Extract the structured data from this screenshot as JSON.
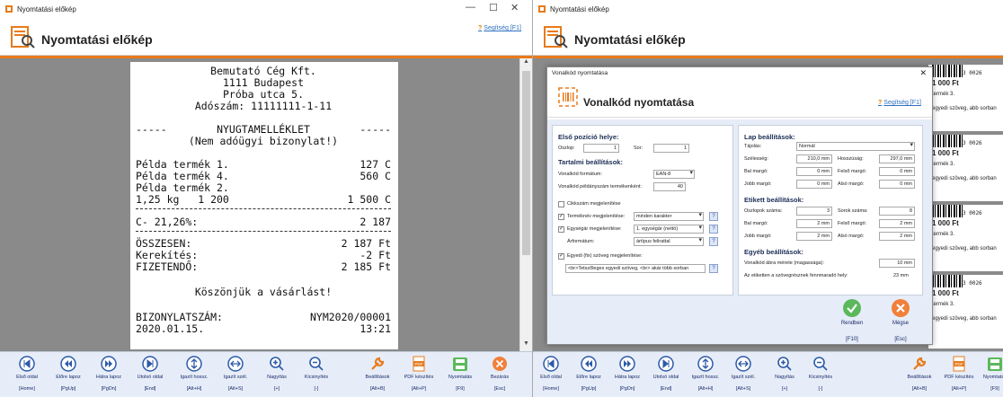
{
  "left": {
    "window_title": "Nyomtatási előkép",
    "header_title": "Nyomtatási előkép",
    "help_link": "Segítség [F1]",
    "receipt": {
      "company": "Bemutató Cég Kft.",
      "city": "1111 Budapest",
      "street": "Próba utca 5.",
      "tax_id": "Adószám: 11111111-1-11",
      "doc_title": "NYUGTAMELLÉKLET",
      "doc_subtitle": "(Nem adóügyi bizonylat!)",
      "items": [
        {
          "name": "Példa termék 1.",
          "amount": "127 C"
        },
        {
          "name": "Példa termék 4.",
          "amount": "560 C"
        },
        {
          "name": "Példa termék 2.",
          "amount": ""
        },
        {
          "name": "1,25 kg   1 200",
          "amount": "1 500 C"
        }
      ],
      "discount_label": "C- 21,26%:",
      "discount_value": "2 187",
      "total_label": "ÖSSZESEN:",
      "total_value": "2 187 Ft",
      "rounding_label": "Kerekítés:",
      "rounding_value": "-2 Ft",
      "payable_label": "FIZETENDŐ:",
      "payable_value": "2 185 Ft",
      "thanks": "Köszönjük a vásárlást!",
      "doc_number_label": "BIZONYLATSZÁM:",
      "doc_number": "NYM2020/00001",
      "date": "2020.01.15.",
      "time": "13:21"
    },
    "toolbar": [
      {
        "label": "Első oldal",
        "key": "[Home]",
        "icon": "first-page-icon"
      },
      {
        "label": "Előre lapoz",
        "key": "[PgUp]",
        "icon": "prev-page-icon"
      },
      {
        "label": "Hátra lapoz",
        "key": "[PgDn]",
        "icon": "next-page-icon"
      },
      {
        "label": "Utolsó oldal",
        "key": "[End]",
        "icon": "last-page-icon"
      },
      {
        "label": "Igazít hossz.",
        "key": "[Alt+H]",
        "icon": "fit-height-icon"
      },
      {
        "label": "Igazít szél.",
        "key": "[Alt+S]",
        "icon": "fit-width-icon"
      },
      {
        "label": "Nagyítás",
        "key": "[+]",
        "icon": "zoom-in-icon"
      },
      {
        "label": "Kicsinyítés",
        "key": "[-]",
        "icon": "zoom-out-icon"
      },
      {
        "label": "Beállítások",
        "key": "[Alt+B]",
        "icon": "wrench-icon"
      },
      {
        "label": "PDF készítés",
        "key": "[Alt+P]",
        "icon": "pdf-icon"
      },
      {
        "label": "Nyomtatás",
        "key": "[F9]",
        "icon": "printer-icon"
      },
      {
        "label": "Bezárás",
        "key": "[Esc]",
        "icon": "close-circle-icon"
      }
    ]
  },
  "right": {
    "window_title": "Nyomtatási előkép",
    "header_title": "Nyomtatási előkép",
    "help_link": "Segítség [F1]",
    "bg_labels": [
      {
        "barcode_num": "3 0026",
        "price": "1 000 Ft",
        "name": "termék 3.",
        "text": "egyedi szöveg, abb sorban"
      },
      {
        "barcode_num": "3 0026",
        "price": "1 000 Ft",
        "name": "termék 3.",
        "text": "egyedi szöveg, abb sorban"
      },
      {
        "barcode_num": "3 0026",
        "price": "1 000 Ft",
        "name": "termék 3.",
        "text": "egyedi szöveg, abb sorban"
      },
      {
        "barcode_num": "3 0026",
        "price": "1 000 Ft",
        "name": "termék 3.",
        "text": "egyedi szöveg, abb sorban"
      }
    ],
    "dialog": {
      "window_title": "Vonalkód nyomtatása",
      "title": "Vonalkód nyomtatása",
      "help_link": "Segítség [F1]",
      "first_pos": {
        "section": "Első pozíció helye:",
        "col_label": "Oszlop:",
        "col_value": "1",
        "row_label": "Sor:",
        "row_value": "1"
      },
      "content": {
        "section": "Tartalmi beállítások:",
        "format_label": "Vonalkód formátum:",
        "format_value": "EAN-8",
        "copies_label": "Vonalkód példányszám termékenként:",
        "copies_value": "40",
        "item_code_label": "Cikkszám megjelenítése",
        "item_code_checked": false,
        "product_name_label": "Terméknév megjelenítése:",
        "product_name_value": "minden karakter",
        "product_name_checked": true,
        "unit_price_label": "Egységár megjelenítése:",
        "unit_price_value": "1. egységár (nettó)",
        "unit_price_checked": true,
        "price_type_label": "Árformátum:",
        "price_type_value": "ártípus felirattal",
        "custom_text_label": "Egyedi (fix) szöveg megjelenítése:",
        "custom_text_checked": true,
        "custom_text_value": "<br>Tetszőleges egyedi szöveg, <br> akár több sorban"
      },
      "page": {
        "section": "Lap beállítások:",
        "size_label": "Tájolás:",
        "size_value": "Normál",
        "width_label": "Szélesség:",
        "width_value": "210,0 mm",
        "height_label": "Hosszúság:",
        "height_value": "297,0 mm",
        "left_margin_label": "Bal margó:",
        "left_margin_value": "0 mm",
        "top_margin_label": "Felső margó:",
        "top_margin_value": "0 mm",
        "right_margin_label": "Jobb margó:",
        "right_margin_value": "0 mm",
        "bottom_margin_label": "Alsó margó:",
        "bottom_margin_value": "0 mm"
      },
      "label": {
        "section": "Etikett beállítások:",
        "cols_label": "Oszlopok száma:",
        "cols_value": "3",
        "rows_label": "Sorok száma:",
        "rows_value": "8",
        "left_margin_label": "Bal margó:",
        "left_margin_value": "2 mm",
        "top_margin_label": "Felső margó:",
        "top_margin_value": "2 mm",
        "right_margin_label": "Jobb margó:",
        "right_margin_value": "2 mm",
        "bottom_margin_label": "Alsó margó:",
        "bottom_margin_value": "2 mm"
      },
      "other": {
        "section": "Egyéb beállítások:",
        "barcode_height_label": "Vonalkód ábra mérete (magassága):",
        "barcode_height_value": "10 mm",
        "remaining_label": "Az etiketten a szövegrésznek fennmaradó hely:",
        "remaining_value": "23 mm"
      },
      "ok_label": "Rendben",
      "ok_key": "[F10]",
      "cancel_label": "Mégse",
      "cancel_key": "[Esc]"
    },
    "toolbar": [
      {
        "label": "Első oldal",
        "key": "[Home]",
        "icon": "first-page-icon"
      },
      {
        "label": "Előre lapoz",
        "key": "[PgUp]",
        "icon": "prev-page-icon"
      },
      {
        "label": "Hátra lapoz",
        "key": "[PgDn]",
        "icon": "next-page-icon"
      },
      {
        "label": "Utolsó oldal",
        "key": "[End]",
        "icon": "last-page-icon"
      },
      {
        "label": "Igazít hossz.",
        "key": "[Alt+H]",
        "icon": "fit-height-icon"
      },
      {
        "label": "Igazít szél.",
        "key": "[Alt+S]",
        "icon": "fit-width-icon"
      },
      {
        "label": "Nagyítás",
        "key": "[+]",
        "icon": "zoom-in-icon"
      },
      {
        "label": "Kicsinyítés",
        "key": "[-]",
        "icon": "zoom-out-icon"
      },
      {
        "label": "Beállítások",
        "key": "[Alt+B]",
        "icon": "wrench-icon"
      },
      {
        "label": "PDF készítés",
        "key": "[Alt+P]",
        "icon": "pdf-icon"
      },
      {
        "label": "Nyomtatás",
        "key": "[F9]",
        "icon": "printer-icon"
      }
    ]
  },
  "colors": {
    "accent": "#e87a1c",
    "toolbar_bg": "#e6edf8",
    "preview_bg": "#8a8a8a",
    "icon_blue": "#2d5aa8",
    "ok_green": "#5cb85c",
    "cancel_orange": "#f0803a"
  }
}
